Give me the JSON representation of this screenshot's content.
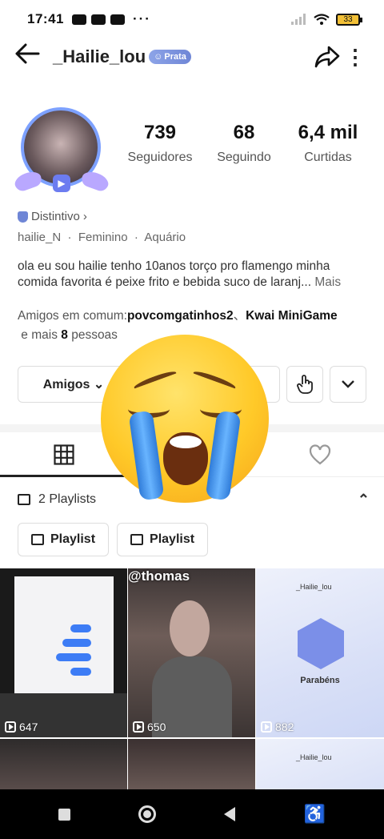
{
  "status_bar": {
    "time": "17:41",
    "dots": "···",
    "battery": "33"
  },
  "header": {
    "username": "_Hailie_lou",
    "badge": "Prata"
  },
  "stats": [
    {
      "value": "739",
      "label": "Seguidores"
    },
    {
      "value": "68",
      "label": "Seguindo"
    },
    {
      "value": "6,4 mil",
      "label": "Curtidas"
    }
  ],
  "profile": {
    "distintivo": "Distintivo",
    "meta": "hailie_N  ·  Feminino  ·  Aquário",
    "bio": "ola eu sou hailie tenho 10anos torço pro flamengo  minha comida favorita é peixe frito e bebida suco de laranj...",
    "bio_more": "Mais",
    "friends_prefix": "Amigos em comum:",
    "friend_1": "povcomgatinhos2",
    "friend_sep": "、",
    "friend_2": "Kwai MiniGame",
    "friends_mid": " e mais ",
    "friends_count": "8",
    "friends_suffix": " pessoas"
  },
  "actions": {
    "amigos_label": "Amigos ⌄"
  },
  "playlists": {
    "header": "2 Playlists",
    "items": [
      "Playlist",
      "Playlist"
    ]
  },
  "grid": {
    "items": [
      {
        "views": "647"
      },
      {
        "views": "650",
        "overlay": "@thomas"
      },
      {
        "views": "882",
        "author": "_Hailie_lou",
        "title": "Parabéns"
      },
      {
        "views": ""
      },
      {
        "views": ""
      },
      {
        "views": "",
        "author": "_Hailie_lou"
      }
    ]
  },
  "colors": {
    "badge": "#6f86d6",
    "accent": "#222222"
  }
}
